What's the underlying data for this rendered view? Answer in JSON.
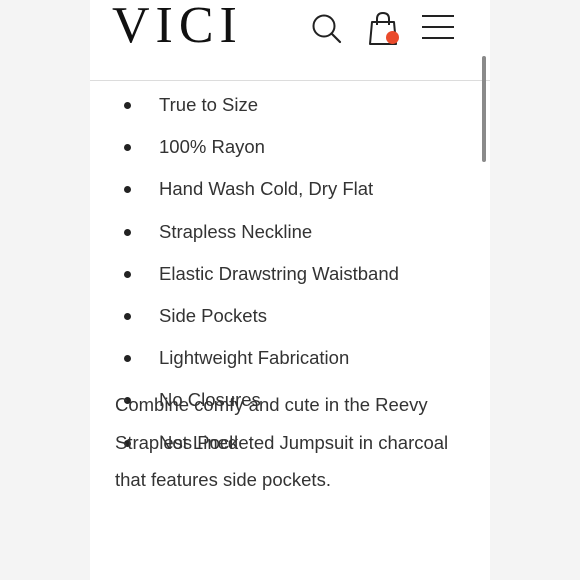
{
  "header": {
    "logo": "VICI",
    "icons": [
      "search-icon",
      "shopping-bag-icon",
      "hamburger-menu-icon"
    ],
    "cart_indicator_color": "#ea4b2c"
  },
  "features": [
    "True to Size",
    "100% Rayon",
    "Hand Wash Cold, Dry Flat",
    "Strapless Neckline",
    "Elastic Drawstring Waistband",
    "Side Pockets",
    "Lightweight Fabrication",
    "No Closures",
    "Not Lined"
  ],
  "description": "Combine comfy and cute in the Reevy Strapless Pocketed Jumpsuit in charcoal that features side pockets."
}
